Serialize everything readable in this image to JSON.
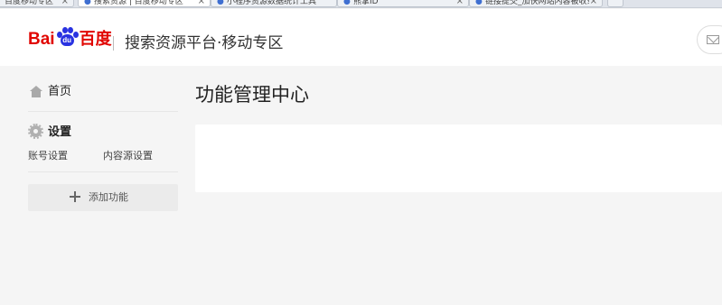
{
  "browser": {
    "tabs": [
      {
        "title": "百度移动专区",
        "active": false
      },
      {
        "title": "搜索资源 | 百度移动专区",
        "active": true
      },
      {
        "title": "小程序资源数据统计工具",
        "active": false
      },
      {
        "title": "熊掌ID",
        "active": false
      },
      {
        "title": "链接提交_加快网站内容被收录",
        "active": false
      }
    ],
    "tab_close_glyph": "×"
  },
  "header": {
    "logo": {
      "left": "Bai",
      "paw": "du",
      "right": "百度"
    },
    "platform_title": "搜索资源平台·移动专区",
    "mail_icon": "mail-icon"
  },
  "sidebar": {
    "home_label": "首页",
    "settings_label": "设置",
    "settings_items": [
      "账号设置",
      "内容源设置"
    ],
    "add_button_label": "添加功能"
  },
  "main": {
    "title": "功能管理中心"
  },
  "colors": {
    "brand_red": "#e10601",
    "brand_blue": "#2932e1",
    "page_bg": "#f5f5f5",
    "card_bg": "#ffffff"
  }
}
